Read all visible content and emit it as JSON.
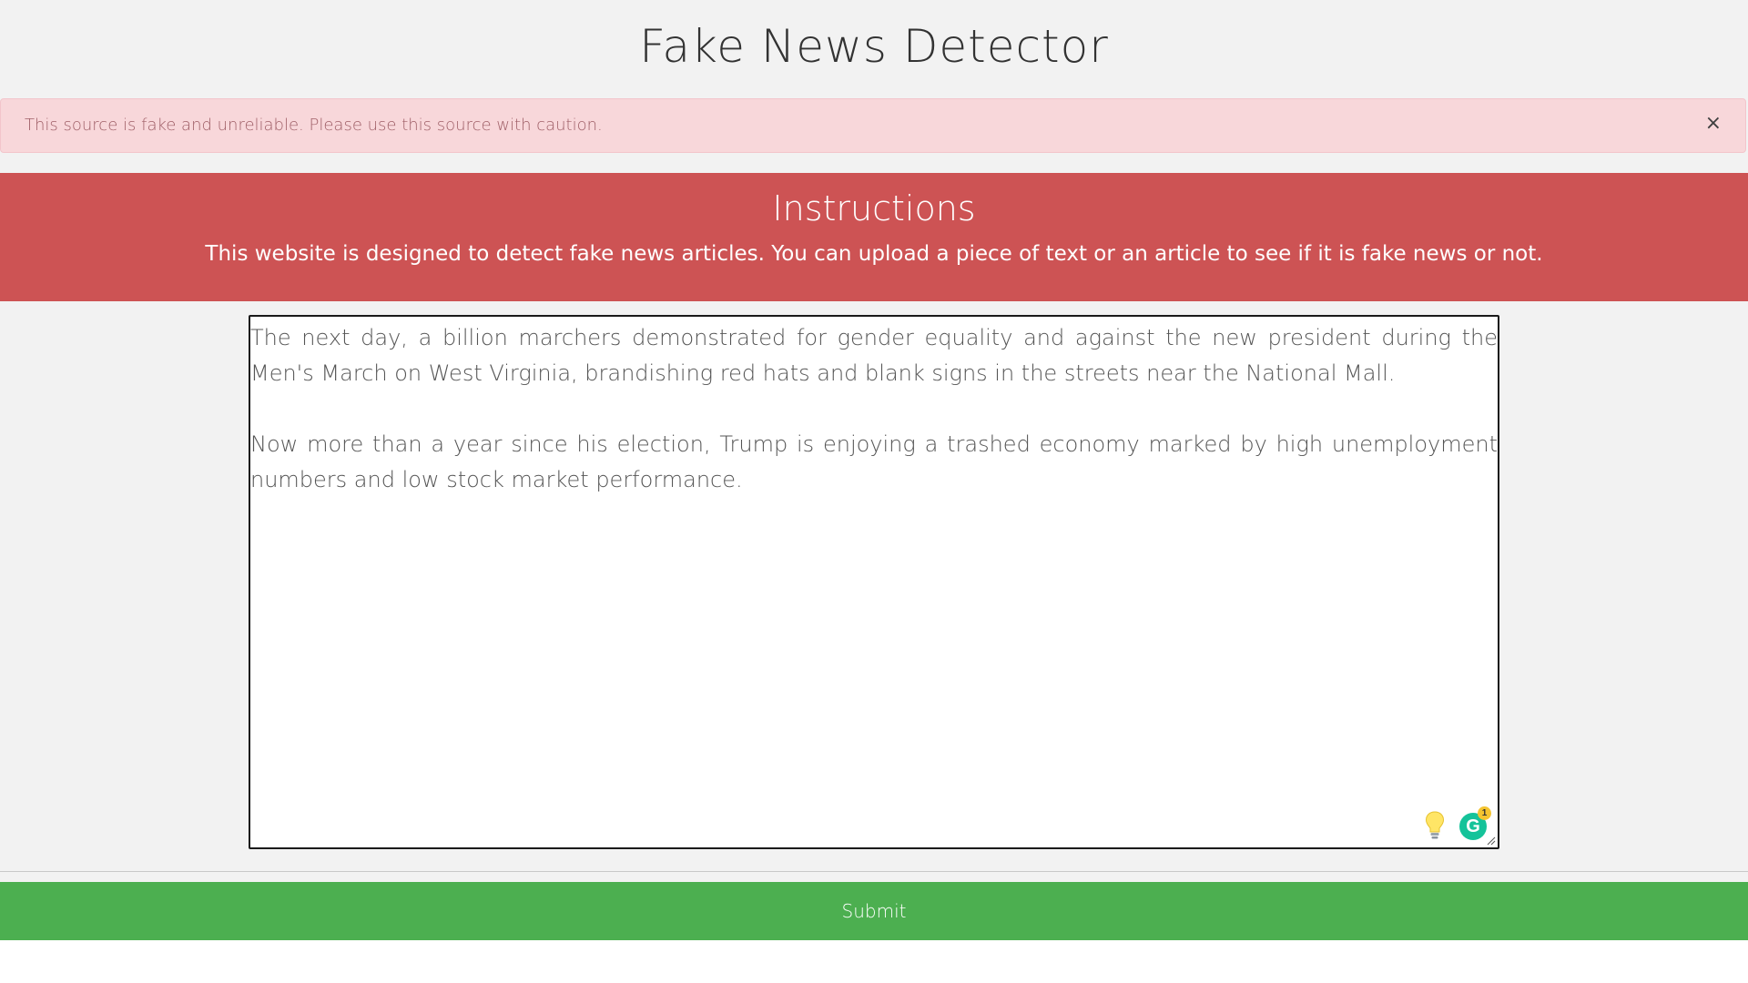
{
  "header": {
    "title": "Fake News Detector"
  },
  "alert": {
    "message": "This source is fake and unreliable. Please use this source with caution.",
    "close_label": "×"
  },
  "instructions": {
    "heading": "Instructions",
    "body": "This website is designed to detect fake news articles. You can upload a piece of text or an article to see if it is fake news or not."
  },
  "editor": {
    "paragraphs": [
      "The next day, a billion marchers demonstrated for gender equality and against the new president during the Men's March on West Virginia, brandishing red hats and blank signs in the streets near the National Mall.",
      "Now more than a year since his election, Trump is enjoying a trashed economy marked by high unemployment numbers and low stock market performance."
    ],
    "grammar_icon_letter": "G",
    "grammar_badge_count": "1",
    "icons": [
      "lightbulb-icon",
      "grammar-assistant-icon",
      "resize-grip-icon"
    ]
  },
  "submit": {
    "label": "Submit"
  },
  "colors": {
    "background": "#f2f2f2",
    "alert_bg": "#f8d7da",
    "instructions_bg": "#cd5354",
    "submit_bg": "#4caf50",
    "grammar_green": "#15c39a",
    "badge_yellow": "#f4c430"
  }
}
